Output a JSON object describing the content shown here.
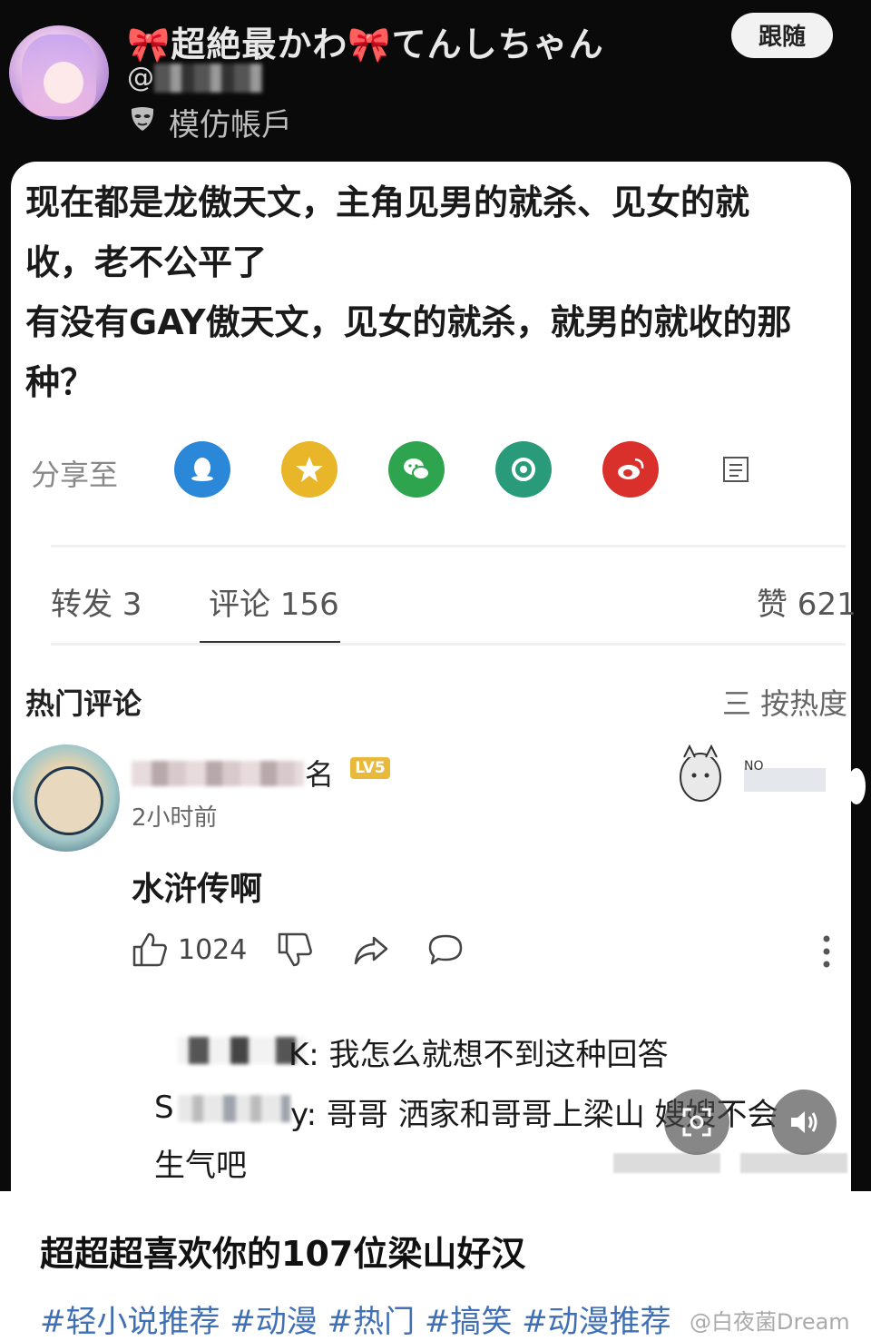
{
  "header": {
    "username": "🎀超絶最かわ🎀てんしちゃん",
    "handle": "@",
    "account_type": "模仿帳戶",
    "follow_label": "跟随"
  },
  "post": {
    "text": "现在都是龙傲天文，主角见男的就杀、见女的就\n收，老不公平了\n有没有GAY傲天文，见女的就杀，就男的就收的那\n种？"
  },
  "share": {
    "label": "分享至",
    "icons": [
      "qq-icon",
      "qzone-star-icon",
      "wechat-icon",
      "moments-icon",
      "weibo-icon",
      "more-share-icon"
    ],
    "colors": [
      "#2b87d8",
      "#e9b62a",
      "#2ea44f",
      "#2a9b7a",
      "#d9302c",
      "#888888"
    ]
  },
  "tabs": {
    "repost": "转发 3",
    "comments": "评论 156",
    "likes": "赞 621"
  },
  "hot": {
    "title": "热门评论",
    "sort": "三 按热度"
  },
  "comment": {
    "name_suffix": "名",
    "badge": "LV5",
    "time": "2小时前",
    "text": "水浒传啊",
    "likes": "1024",
    "sticker_label": "NO"
  },
  "replies": [
    {
      "name_suffix": "K",
      "text": ": 我怎么就想不到这种回答"
    },
    {
      "name_prefix": "S",
      "name_suffix": "y",
      "text": ": 哥哥 洒家和哥哥上梁山 嫂嫂不会"
    }
  ],
  "reply_continuation": "生气吧",
  "footer": {
    "title": "超超超喜欢你的107位梁山好汉",
    "tags": "#轻小说推荐 #动漫 #热门 #搞笑 #动漫推荐",
    "watermark": "@白夜菌Dream"
  },
  "accent_color": "#3f6fb5"
}
